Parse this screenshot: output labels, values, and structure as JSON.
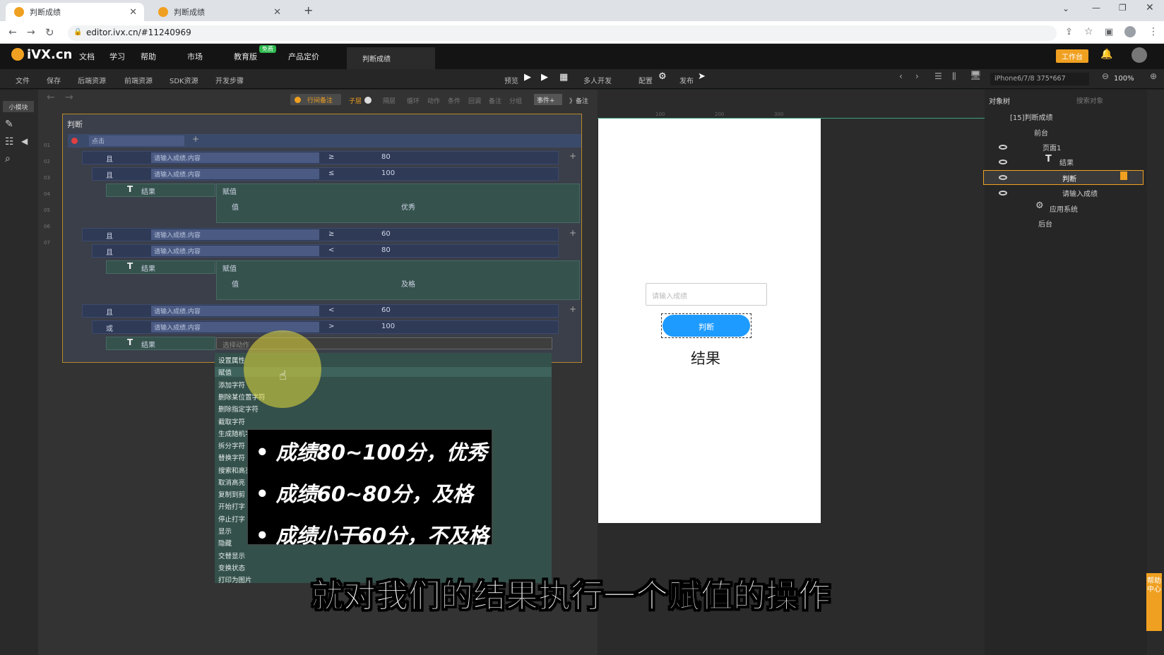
{
  "browser": {
    "tabs": [
      {
        "title": "判断成绩"
      },
      {
        "title": "判断成绩"
      }
    ],
    "url": "editor.ivx.cn/#11240969"
  },
  "nav": {
    "logo": "iVX.cn",
    "items": [
      "文档",
      "学习",
      "帮助",
      "市场",
      "教育版",
      "产品定价"
    ],
    "edu_badge": "免费",
    "project_tab": "判断成绩",
    "workspace_btn": "工作台"
  },
  "toolbar": {
    "left": [
      "文件",
      "保存",
      "后端资源",
      "前端资源",
      "SDK资源",
      "开发步骤"
    ],
    "preview": "预览",
    "multi_dev": "多人开发",
    "config": "配置",
    "publish": "发布",
    "device": "iPhone6/7/8 375*667",
    "zoom": "100%"
  },
  "left_panel": {
    "module_tab": "小模块"
  },
  "editor_toolbar": {
    "row_comment": "行间备注",
    "sublayer": "子层",
    "items": [
      "隔层",
      "循环",
      "动作",
      "条件",
      "回调",
      "备注",
      "分组",
      "事件+",
      "》备注"
    ]
  },
  "event_panel": {
    "title": "判断",
    "trigger": "点击",
    "input_ref": "请输入成绩.内容",
    "conditions": [
      {
        "logic": "且",
        "op": "≥",
        "value": "80"
      },
      {
        "logic": "且",
        "op": "≤",
        "value": "100"
      },
      {
        "logic": "且",
        "op": "≥",
        "value": "60"
      },
      {
        "logic": "且",
        "op": "<",
        "value": "80"
      },
      {
        "logic": "且",
        "op": "<",
        "value": "60"
      },
      {
        "logic": "或",
        "op": ">",
        "value": "100"
      }
    ],
    "target": "结果",
    "action": "赋值",
    "value_label": "值",
    "results": [
      "优秀",
      "及格"
    ],
    "select_action_placeholder": "选择动作"
  },
  "action_menu": [
    "设置属性",
    "赋值",
    "添加字符",
    "删除某位置字符",
    "删除指定字符",
    "截取字符",
    "生成随机字符",
    "拆分字符",
    "替换字符",
    "搜索和高亮",
    "取消高亮",
    "复制到剪",
    "开始打字",
    "停止打字",
    "显示",
    "隐藏",
    "交替显示",
    "变换状态",
    "打印为图片"
  ],
  "tooltip_lines": [
    "成绩80~100分，优秀",
    "成绩60~80分，及格",
    "成绩小于60分，不及格"
  ],
  "ruler": [
    "100",
    "200",
    "300"
  ],
  "phone": {
    "input_placeholder": "请输入成绩",
    "button": "判断",
    "result": "结果"
  },
  "object_tree": {
    "title": "对象树",
    "search_placeholder": "搜索对象",
    "nodes": [
      "[15]判断成绩",
      "前台",
      "页面1",
      "结果",
      "判断",
      "请输入成绩",
      "应用系统",
      "后台"
    ]
  },
  "help_center": "帮助中心",
  "subtitle": "就对我们的结果执行一个赋值的操作",
  "colors": {
    "accent": "#1e9bff",
    "highlight": "#f0a020"
  }
}
